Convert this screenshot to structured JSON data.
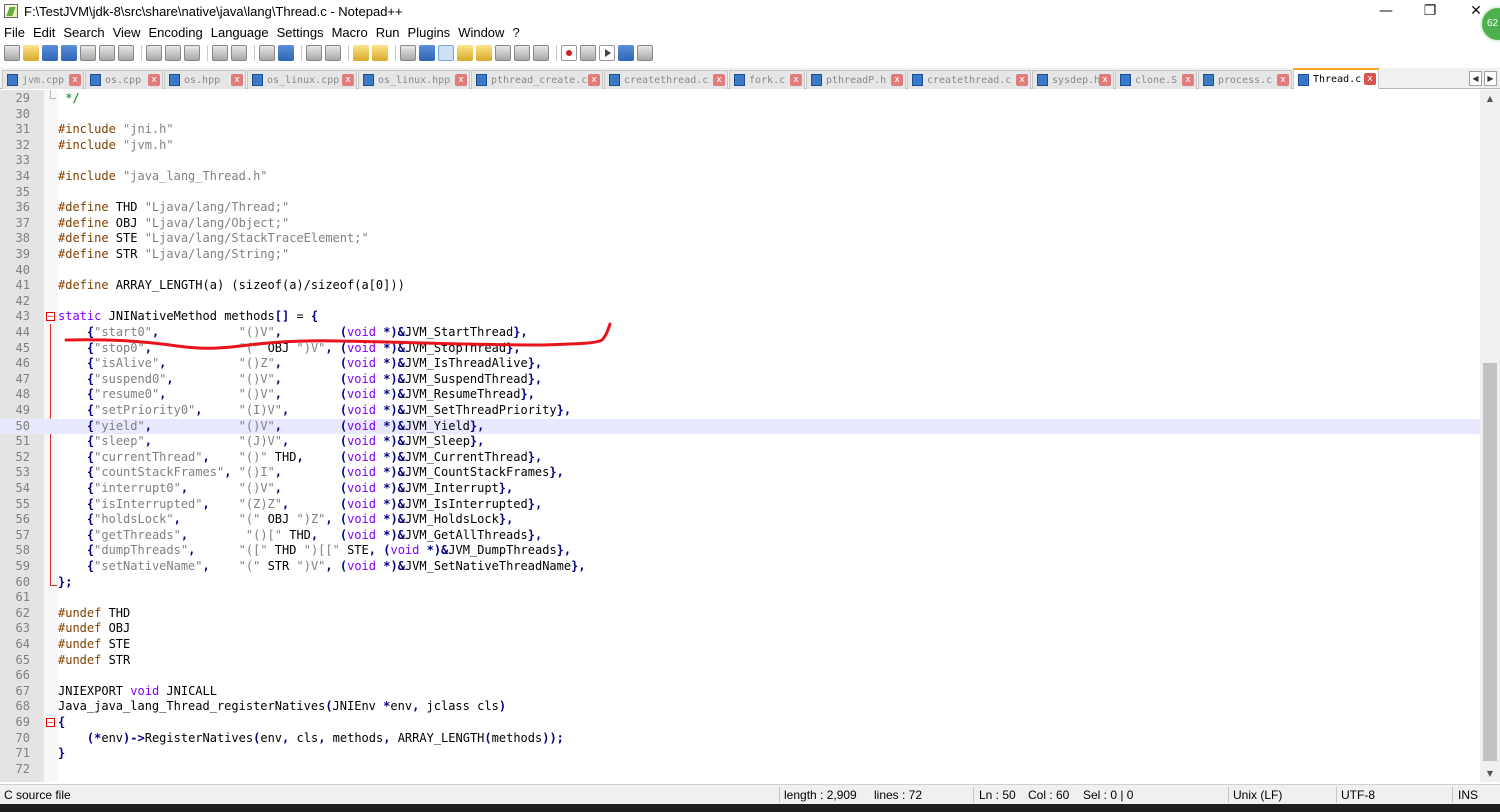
{
  "window": {
    "title": "F:\\TestJVM\\jdk-8\\src\\share\\native\\java\\lang\\Thread.c - Notepad++",
    "minimize": "—",
    "maximize": "❐",
    "close": "✕",
    "badge": "62"
  },
  "menu": [
    "File",
    "Edit",
    "Search",
    "View",
    "Encoding",
    "Language",
    "Settings",
    "Macro",
    "Run",
    "Plugins",
    "Window",
    "?"
  ],
  "tabs": [
    {
      "label": "jvm.cpp"
    },
    {
      "label": "os.cpp"
    },
    {
      "label": "os.hpp"
    },
    {
      "label": "os_linux.cpp"
    },
    {
      "label": "os_linux.hpp"
    },
    {
      "label": "pthread_create.c"
    },
    {
      "label": "createthread.c"
    },
    {
      "label": "fork.c"
    },
    {
      "label": "pthreadP.h"
    },
    {
      "label": "createthread.c"
    },
    {
      "label": "sysdep.h"
    },
    {
      "label": "clone.S"
    },
    {
      "label": "process.c"
    },
    {
      "label": "Thread.c",
      "active": true
    }
  ],
  "tab_close_glyph": "x",
  "tab_scroll": {
    "left": "◀",
    "right": "▶"
  },
  "editor": {
    "current_line": 50,
    "lines": [
      {
        "n": "29",
        "c": " */"
      },
      {
        "n": "30",
        "c": ""
      },
      {
        "n": "31",
        "c": "#include \"jni.h\""
      },
      {
        "n": "32",
        "c": "#include \"jvm.h\""
      },
      {
        "n": "33",
        "c": ""
      },
      {
        "n": "34",
        "c": "#include \"java_lang_Thread.h\""
      },
      {
        "n": "35",
        "c": ""
      },
      {
        "n": "36",
        "c": "#define THD \"Ljava/lang/Thread;\""
      },
      {
        "n": "37",
        "c": "#define OBJ \"Ljava/lang/Object;\""
      },
      {
        "n": "38",
        "c": "#define STE \"Ljava/lang/StackTraceElement;\""
      },
      {
        "n": "39",
        "c": "#define STR \"Ljava/lang/String;\""
      },
      {
        "n": "40",
        "c": ""
      },
      {
        "n": "41",
        "c": "#define ARRAY_LENGTH(a) (sizeof(a)/sizeof(a[0]))"
      },
      {
        "n": "42",
        "c": ""
      },
      {
        "n": "43",
        "c": "static JNINativeMethod methods[] = {"
      },
      {
        "n": "44",
        "c": "    {\"start0\",           \"()V\",        (void *)&JVM_StartThread},"
      },
      {
        "n": "45",
        "c": "    {\"stop0\",            \"(\" OBJ \")V\", (void *)&JVM_StopThread},"
      },
      {
        "n": "46",
        "c": "    {\"isAlive\",          \"()Z\",        (void *)&JVM_IsThreadAlive},"
      },
      {
        "n": "47",
        "c": "    {\"suspend0\",         \"()V\",        (void *)&JVM_SuspendThread},"
      },
      {
        "n": "48",
        "c": "    {\"resume0\",          \"()V\",        (void *)&JVM_ResumeThread},"
      },
      {
        "n": "49",
        "c": "    {\"setPriority0\",     \"(I)V\",       (void *)&JVM_SetThreadPriority},"
      },
      {
        "n": "50",
        "c": "    {\"yield\",            \"()V\",        (void *)&JVM_Yield},"
      },
      {
        "n": "51",
        "c": "    {\"sleep\",            \"(J)V\",       (void *)&JVM_Sleep},"
      },
      {
        "n": "52",
        "c": "    {\"currentThread\",    \"()\" THD,     (void *)&JVM_CurrentThread},"
      },
      {
        "n": "53",
        "c": "    {\"countStackFrames\", \"()I\",        (void *)&JVM_CountStackFrames},"
      },
      {
        "n": "54",
        "c": "    {\"interrupt0\",       \"()V\",        (void *)&JVM_Interrupt},"
      },
      {
        "n": "55",
        "c": "    {\"isInterrupted\",    \"(Z)Z\",       (void *)&JVM_IsInterrupted},"
      },
      {
        "n": "56",
        "c": "    {\"holdsLock\",        \"(\" OBJ \")Z\", (void *)&JVM_HoldsLock},"
      },
      {
        "n": "57",
        "c": "    {\"getThreads\",        \"()[\" THD,   (void *)&JVM_GetAllThreads},"
      },
      {
        "n": "58",
        "c": "    {\"dumpThreads\",      \"([\" THD \")[[\" STE, (void *)&JVM_DumpThreads},"
      },
      {
        "n": "59",
        "c": "    {\"setNativeName\",    \"(\" STR \")V\", (void *)&JVM_SetNativeThreadName},"
      },
      {
        "n": "60",
        "c": "};"
      },
      {
        "n": "61",
        "c": ""
      },
      {
        "n": "62",
        "c": "#undef THD"
      },
      {
        "n": "63",
        "c": "#undef OBJ"
      },
      {
        "n": "64",
        "c": "#undef STE"
      },
      {
        "n": "65",
        "c": "#undef STR"
      },
      {
        "n": "66",
        "c": ""
      },
      {
        "n": "67",
        "c": "JNIEXPORT void JNICALL"
      },
      {
        "n": "68",
        "c": "Java_java_lang_Thread_registerNatives(JNIEnv *env, jclass cls)"
      },
      {
        "n": "69",
        "c": "{"
      },
      {
        "n": "70",
        "c": "    (*env)->RegisterNatives(env, cls, methods, ARRAY_LENGTH(methods));"
      },
      {
        "n": "71",
        "c": "}"
      },
      {
        "n": "72",
        "c": ""
      }
    ]
  },
  "scrollbar": {
    "up": "▲",
    "down": "▼"
  },
  "status": {
    "file_type": "C source file",
    "length": "length : 2,909",
    "lines": "lines : 72",
    "ln": "Ln : 50",
    "col": "Col : 60",
    "sel": "Sel : 0 | 0",
    "eol": "Unix (LF)",
    "encoding": "UTF-8",
    "mode": "INS"
  },
  "colors": {
    "annotation": "#e8141c",
    "current_line": "#e8e8ff",
    "keyword": "#8000ff",
    "preprocessor": "#804000",
    "string": "#808080"
  }
}
